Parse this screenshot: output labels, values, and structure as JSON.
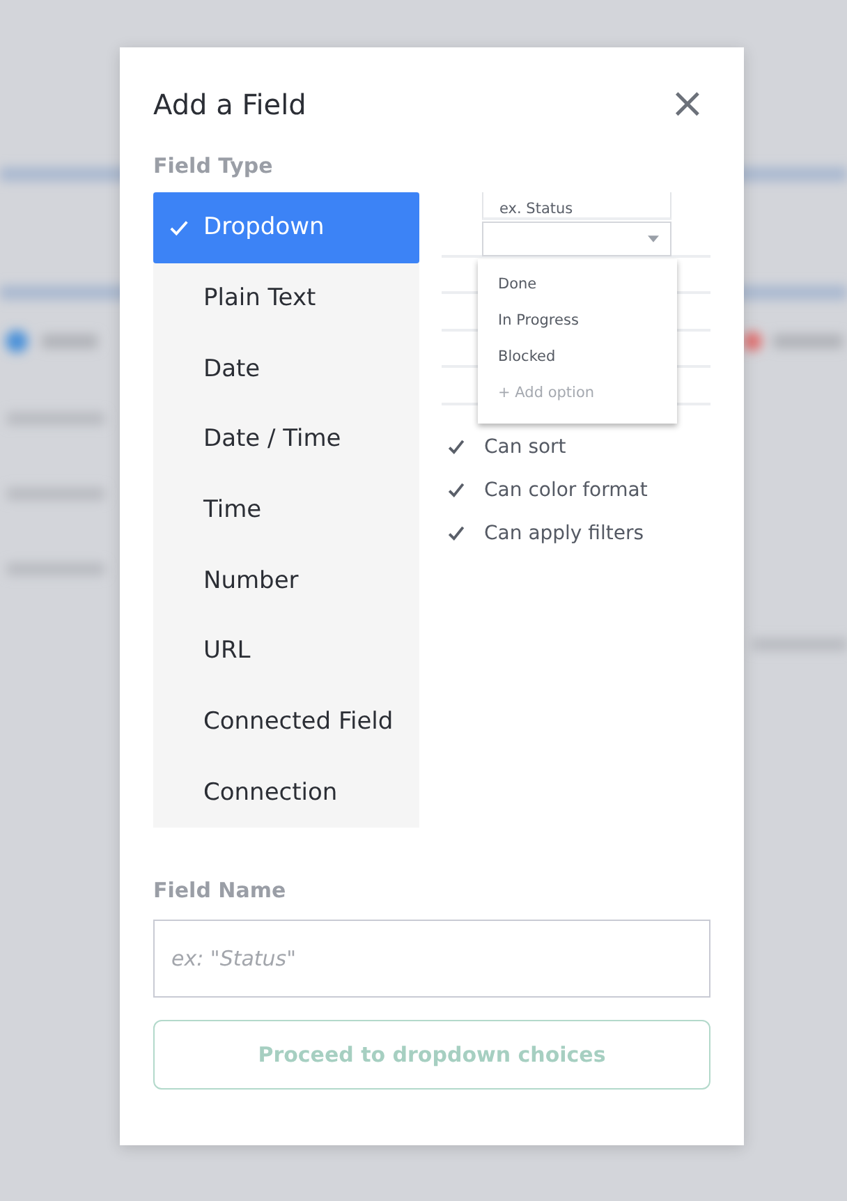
{
  "dialog": {
    "title": "Add a Field",
    "close": "×"
  },
  "field_type": {
    "label": "Field Type",
    "items": [
      {
        "label": "Dropdown",
        "selected": true
      },
      {
        "label": "Plain Text",
        "selected": false
      },
      {
        "label": "Date",
        "selected": false
      },
      {
        "label": "Date / Time",
        "selected": false
      },
      {
        "label": "Time",
        "selected": false
      },
      {
        "label": "Number",
        "selected": false
      },
      {
        "label": "URL",
        "selected": false
      },
      {
        "label": "Connected Field",
        "selected": false
      },
      {
        "label": "Connection",
        "selected": false
      }
    ]
  },
  "preview": {
    "header": "ex. Status",
    "options": [
      {
        "label": "Done",
        "kind": "option"
      },
      {
        "label": "In Progress",
        "kind": "option"
      },
      {
        "label": "Blocked",
        "kind": "option"
      },
      {
        "label": "+ Add option",
        "kind": "add"
      }
    ],
    "capabilities": [
      "Can sort",
      "Can color format",
      "Can apply filters"
    ]
  },
  "field_name": {
    "label": "Field Name",
    "placeholder": "ex: \"Status\""
  },
  "button": {
    "label": "Proceed to dropdown choices",
    "disabled": true
  }
}
